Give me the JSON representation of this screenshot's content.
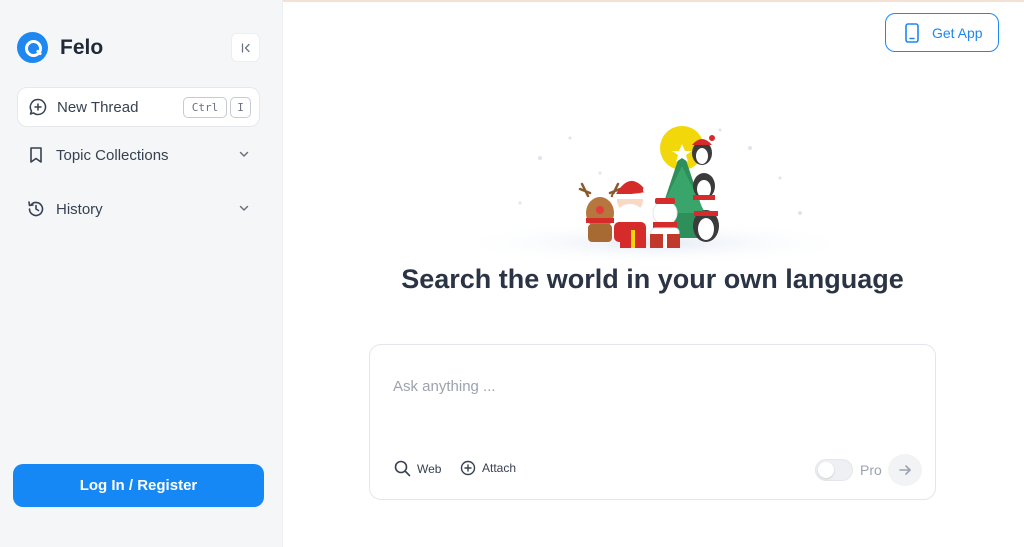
{
  "brand": {
    "name": "Felo",
    "color": "#1e87f0"
  },
  "sidebar": {
    "new_thread": {
      "label": "New Thread",
      "shortcut_key1": "Ctrl",
      "shortcut_key2": "I"
    },
    "items": [
      {
        "label": "Topic Collections",
        "icon": "bookmark-icon"
      },
      {
        "label": "History",
        "icon": "history-icon"
      }
    ],
    "login_label": "Log In / Register"
  },
  "header": {
    "get_app_label": "Get App"
  },
  "main": {
    "headline": "Search the world in your own language",
    "search": {
      "placeholder": "Ask anything ...",
      "value": "",
      "web_label": "Web",
      "attach_label": "Attach",
      "pro_label": "Pro",
      "pro_enabled": false
    }
  },
  "colors": {
    "accent": "#1588f5",
    "sidebar_bg": "#f4f6f8",
    "headline": "#2b3445"
  }
}
